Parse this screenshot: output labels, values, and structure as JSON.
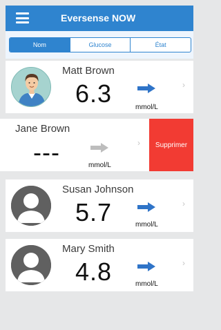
{
  "header": {
    "title": "Eversense NOW",
    "menu_icon": "hamburger-menu-icon"
  },
  "tabs": [
    {
      "label": "Nom",
      "active": true
    },
    {
      "label": "Glucose",
      "active": false
    },
    {
      "label": "État",
      "active": false
    }
  ],
  "rows": [
    {
      "name": "Matt Brown",
      "value": "6.3",
      "unit": "mmol/L",
      "trend": "right",
      "avatar": "person-photo"
    },
    {
      "name": "Jane Brown",
      "value": "---",
      "unit": "mmol/L",
      "trend": "right-gray",
      "avatar": "none"
    },
    {
      "name": "Susan Johnson",
      "value": "5.7",
      "unit": "mmol/L",
      "trend": "right",
      "avatar": "placeholder"
    },
    {
      "name": "Mary Smith",
      "value": "4.8",
      "unit": "mmol/L",
      "trend": "right",
      "avatar": "placeholder"
    }
  ],
  "delete_label": "Supprimer",
  "chevron": "›",
  "colors": {
    "accent": "#2f84cf",
    "delete": "#f23b33",
    "arrow_active": "#2f74c8",
    "arrow_inactive": "#bdbdbd"
  }
}
